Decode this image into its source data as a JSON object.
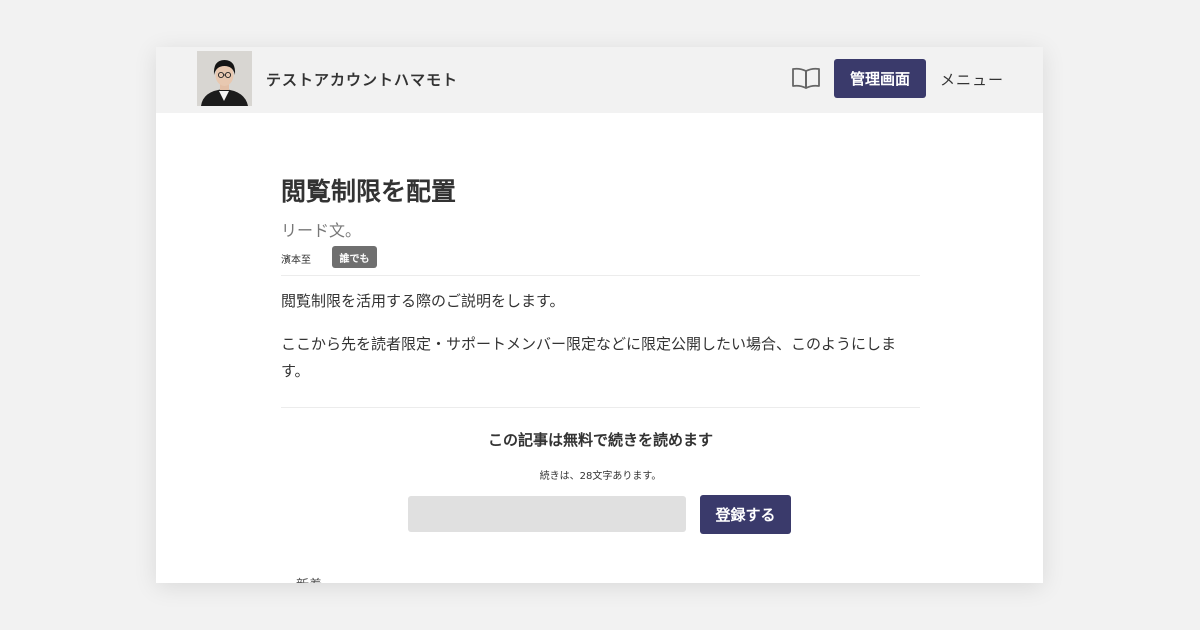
{
  "header": {
    "site_name": "テストアカウントハマモト",
    "admin_button": "管理画面",
    "menu_label": "メニュー",
    "book_icon": "book-open-icon"
  },
  "article": {
    "title": "閲覧制限を配置",
    "lead": "リード文。",
    "author": "濱本至",
    "access_badge": "誰でも",
    "paragraphs": [
      "閲覧制限を活用する際のご説明をします。",
      "ここから先を読者限定・サポートメンバー限定などに限定公開したい場合、このようにします。"
    ]
  },
  "paywall": {
    "title": "この記事は無料で続きを読めます",
    "subtitle": "続きは、28文字あります。",
    "register_button": "登録する"
  },
  "footer": {
    "clipped_label": "新着"
  },
  "colors": {
    "page_background": "#f2f2f2",
    "header_background": "#f2f2f2",
    "accent": "#3a3a6b",
    "badge": "#6f6f6f",
    "input_background": "#e0e0e0"
  }
}
